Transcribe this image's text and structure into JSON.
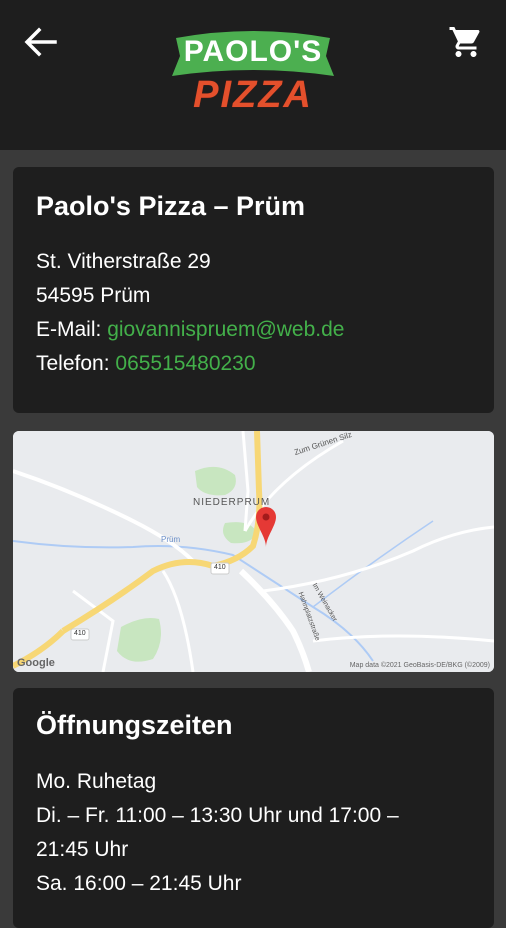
{
  "header": {
    "back_icon": "arrow-left-icon",
    "cart_icon": "shopping-cart-icon",
    "logo_line1": "PAOLO'S",
    "logo_line2": "PIZZA",
    "logo_colors": {
      "banner": "#4caf50",
      "pizza": "#e4502c"
    }
  },
  "info": {
    "title": "Paolo's Pizza – Prüm",
    "street": "St. Vitherstraße 29",
    "city": "54595 Prüm",
    "email_label": "E-Mail: ",
    "email": "giovannispruem@web.de",
    "phone_label": "Telefon: ",
    "phone": "065515480230"
  },
  "map": {
    "place_label": "NIEDERPRUM",
    "road_label": "Zum Grünen Silz",
    "road_label2": "Prüm",
    "road_label3": "Im Weinacker",
    "road_label4": "Hahnplatzstraße",
    "road_number": "410",
    "google": "Google",
    "attribution": "Map data ©2021 GeoBasis-DE/BKG (©2009)",
    "pin_icon": "map-pin-icon",
    "pin_color": "#e53935"
  },
  "hours": {
    "title": "Öffnungszeiten",
    "lines": [
      "Mo. Ruhetag",
      "Di. – Fr. 11:00 – 13:30 Uhr und 17:00 –",
      "21:45 Uhr",
      "Sa. 16:00 – 21:45 Uhr"
    ]
  },
  "colors": {
    "accent_green": "#43b04a",
    "card_bg": "#1e1e1e",
    "page_bg": "#3a3a3a"
  }
}
